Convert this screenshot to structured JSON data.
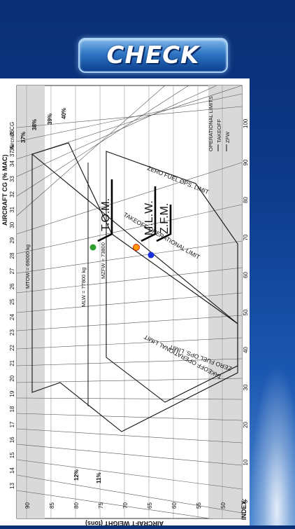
{
  "header": {
    "check_button": "CHECK"
  },
  "chart": {
    "left_axis_title": "AIRCRAFT CG (% MAC)",
    "left_axis_sub": "37 Aircraft CG",
    "cg_ticks": [
      "13",
      "14",
      "15",
      "16",
      "17",
      "18",
      "19",
      "20",
      "21",
      "22",
      "23",
      "24",
      "25",
      "26",
      "27",
      "28",
      "29",
      "30",
      "31",
      "32",
      "33",
      "34",
      "35",
      "36"
    ],
    "weight_ticks": [
      "90",
      "85",
      "80",
      "75",
      "70",
      "65",
      "60",
      "55",
      "50"
    ],
    "weight_axis_title": "AIRCRAFT WEIGHT (tons)",
    "index_label": "INDEX:",
    "index_ticks": [
      "0",
      "10",
      "20",
      "30",
      "40",
      "50",
      "60",
      "70",
      "80",
      "90",
      "100"
    ],
    "mac_labels": [
      "37%",
      "38%",
      "39%",
      "40%",
      "12%",
      "11%"
    ],
    "legend_title": "OPERATIONAL LIMITS",
    "legend_takeoff": "TAKEOFF",
    "legend_zfw": "ZFW",
    "limit_zfo_top": "ZERO FUEL OPS. LIMIT",
    "limit_to_top": "TAKEOFF OPERATIONAL LIMIT",
    "limit_zfo_bottom": "ZERO FUEL OPS. LIMIT",
    "limit_to_bottom": "TAKEOFF OPERATIONAL LIMIT",
    "mtow": "MTOW = 69000 kg",
    "mlw": "MLW = 77800 kg",
    "mzfw": "MZFW = 73800",
    "tom_mark": "T.O.M.",
    "mlw_mark": "M.L.W.",
    "zfm_mark": "Z.F.M."
  },
  "points": [
    {
      "name": "green",
      "color": "#2e9e2e"
    },
    {
      "name": "orange",
      "color": "#ff9a00"
    },
    {
      "name": "blue",
      "color": "#1a2ee0"
    }
  ]
}
